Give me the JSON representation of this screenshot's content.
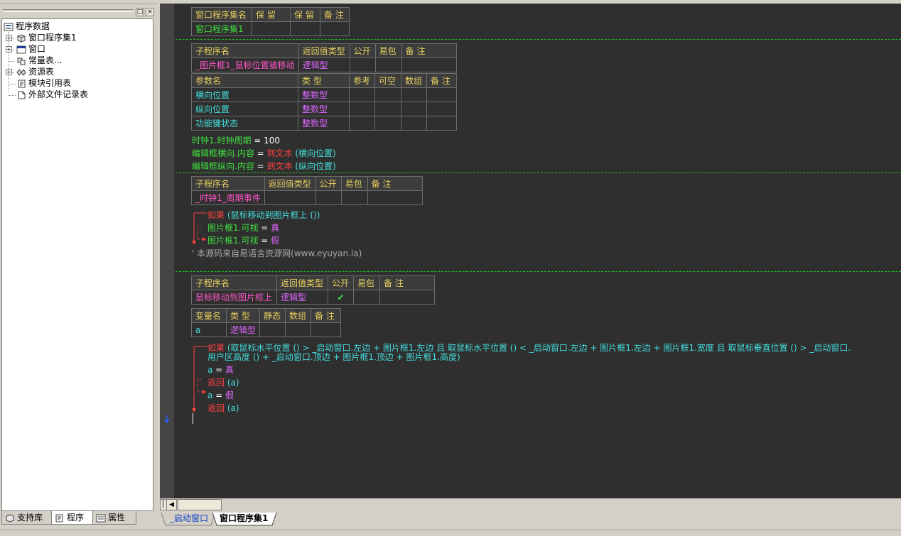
{
  "tree": {
    "root": "程序数据",
    "items": [
      "窗口程序集1",
      "窗口",
      "常量表...",
      "资源表",
      "模块引用表",
      "外部文件记录表"
    ]
  },
  "panel_buttons": {
    "pin": "□",
    "close": "×"
  },
  "left_tabs": {
    "library": "支持库",
    "program": "程序",
    "property": "属性"
  },
  "assembly_table": {
    "headers": [
      "窗口程序集名",
      "保 留",
      "保 留",
      "备 注"
    ],
    "row": [
      "窗口程序集1",
      "",
      "",
      ""
    ]
  },
  "sub1": {
    "headers": [
      "子程序名",
      "返回值类型",
      "公开",
      "易包",
      "备 注"
    ],
    "row": [
      "_图片框1_鼠标位置被移动",
      "逻辑型",
      "",
      "",
      ""
    ],
    "param_headers": [
      "参数名",
      "类 型",
      "参考",
      "可空",
      "数组",
      "备 注"
    ],
    "params": [
      [
        "横向位置",
        "整数型"
      ],
      [
        "纵向位置",
        "整数型"
      ],
      [
        "功能键状态",
        "整数型"
      ]
    ],
    "lines": [
      {
        "a": "时钟1.时钟周期",
        "op": " = ",
        "b": "100"
      },
      {
        "a": "编辑框横向.内容",
        "op": " = ",
        "fn": "到文本",
        "arg": " (横向位置)"
      },
      {
        "a": "编辑框纵向.内容",
        "op": " = ",
        "fn": "到文本",
        "arg": " (纵向位置)"
      }
    ]
  },
  "sub2": {
    "headers": [
      "子程序名",
      "返回值类型",
      "公开",
      "易包",
      "备 注"
    ],
    "row": [
      "_时钟1_周期事件",
      "",
      "",
      "",
      ""
    ],
    "if_kw": "如果",
    "if_cond": " (鼠标移动到图片框上 ())",
    "line1": "图片框1.可视",
    "line1_val": "真",
    "line2": "图片框1.可视",
    "line2_val": "假",
    "eq": " = ",
    "comment": "' 本源码来自易语言资源网(www.eyuyan.la)"
  },
  "sub3": {
    "headers": [
      "子程序名",
      "返回值类型",
      "公开",
      "易包",
      "备 注"
    ],
    "row": [
      "鼠标移动到图片框上",
      "逻辑型",
      "✔",
      "",
      ""
    ],
    "var_headers": [
      "变量名",
      "类 型",
      "静态",
      "数组",
      "备 注"
    ],
    "var_row": [
      "a",
      "逻辑型",
      "",
      "",
      ""
    ],
    "if_kw": "如果",
    "if_line1": " (取鼠标水平位置 () > _启动窗口.左边 + 图片框1.左边 且 取鼠标水平位置 () < _启动窗口.左边 + 图片框1.左边 + 图片框1.宽度 且 取鼠标垂直位置 () > _启动窗口.",
    "if_line2": "用户区高度 () + _启动窗口.顶边 + 图片框1.顶边 + 图片框1.高度)",
    "a_true_var": "a",
    "a_true_val": "真",
    "ret_kw": "返回",
    "ret_arg": " (a)",
    "a_false_var": "a",
    "a_false_val": "假",
    "eq": " = "
  },
  "editor_tabs": {
    "startup_window": "_启动窗口",
    "assembly": "窗口程序集1"
  },
  "colors": {
    "editor_bg": "#2f2f2f",
    "table_header_text": "#e8d060",
    "sub_name": "#ff55c8",
    "type_text": "#dd66ff",
    "param_text": "#44dddd",
    "separator": "#22c322",
    "keyword": "#ff4040"
  },
  "icons": [
    "tree-root-icon",
    "module-icon",
    "window-icon",
    "constants-icon",
    "resources-icon",
    "module-ref-icon",
    "file-record-icon",
    "library-icon",
    "program-icon",
    "property-icon",
    "checkmark-icon",
    "arrow-down-icon"
  ]
}
